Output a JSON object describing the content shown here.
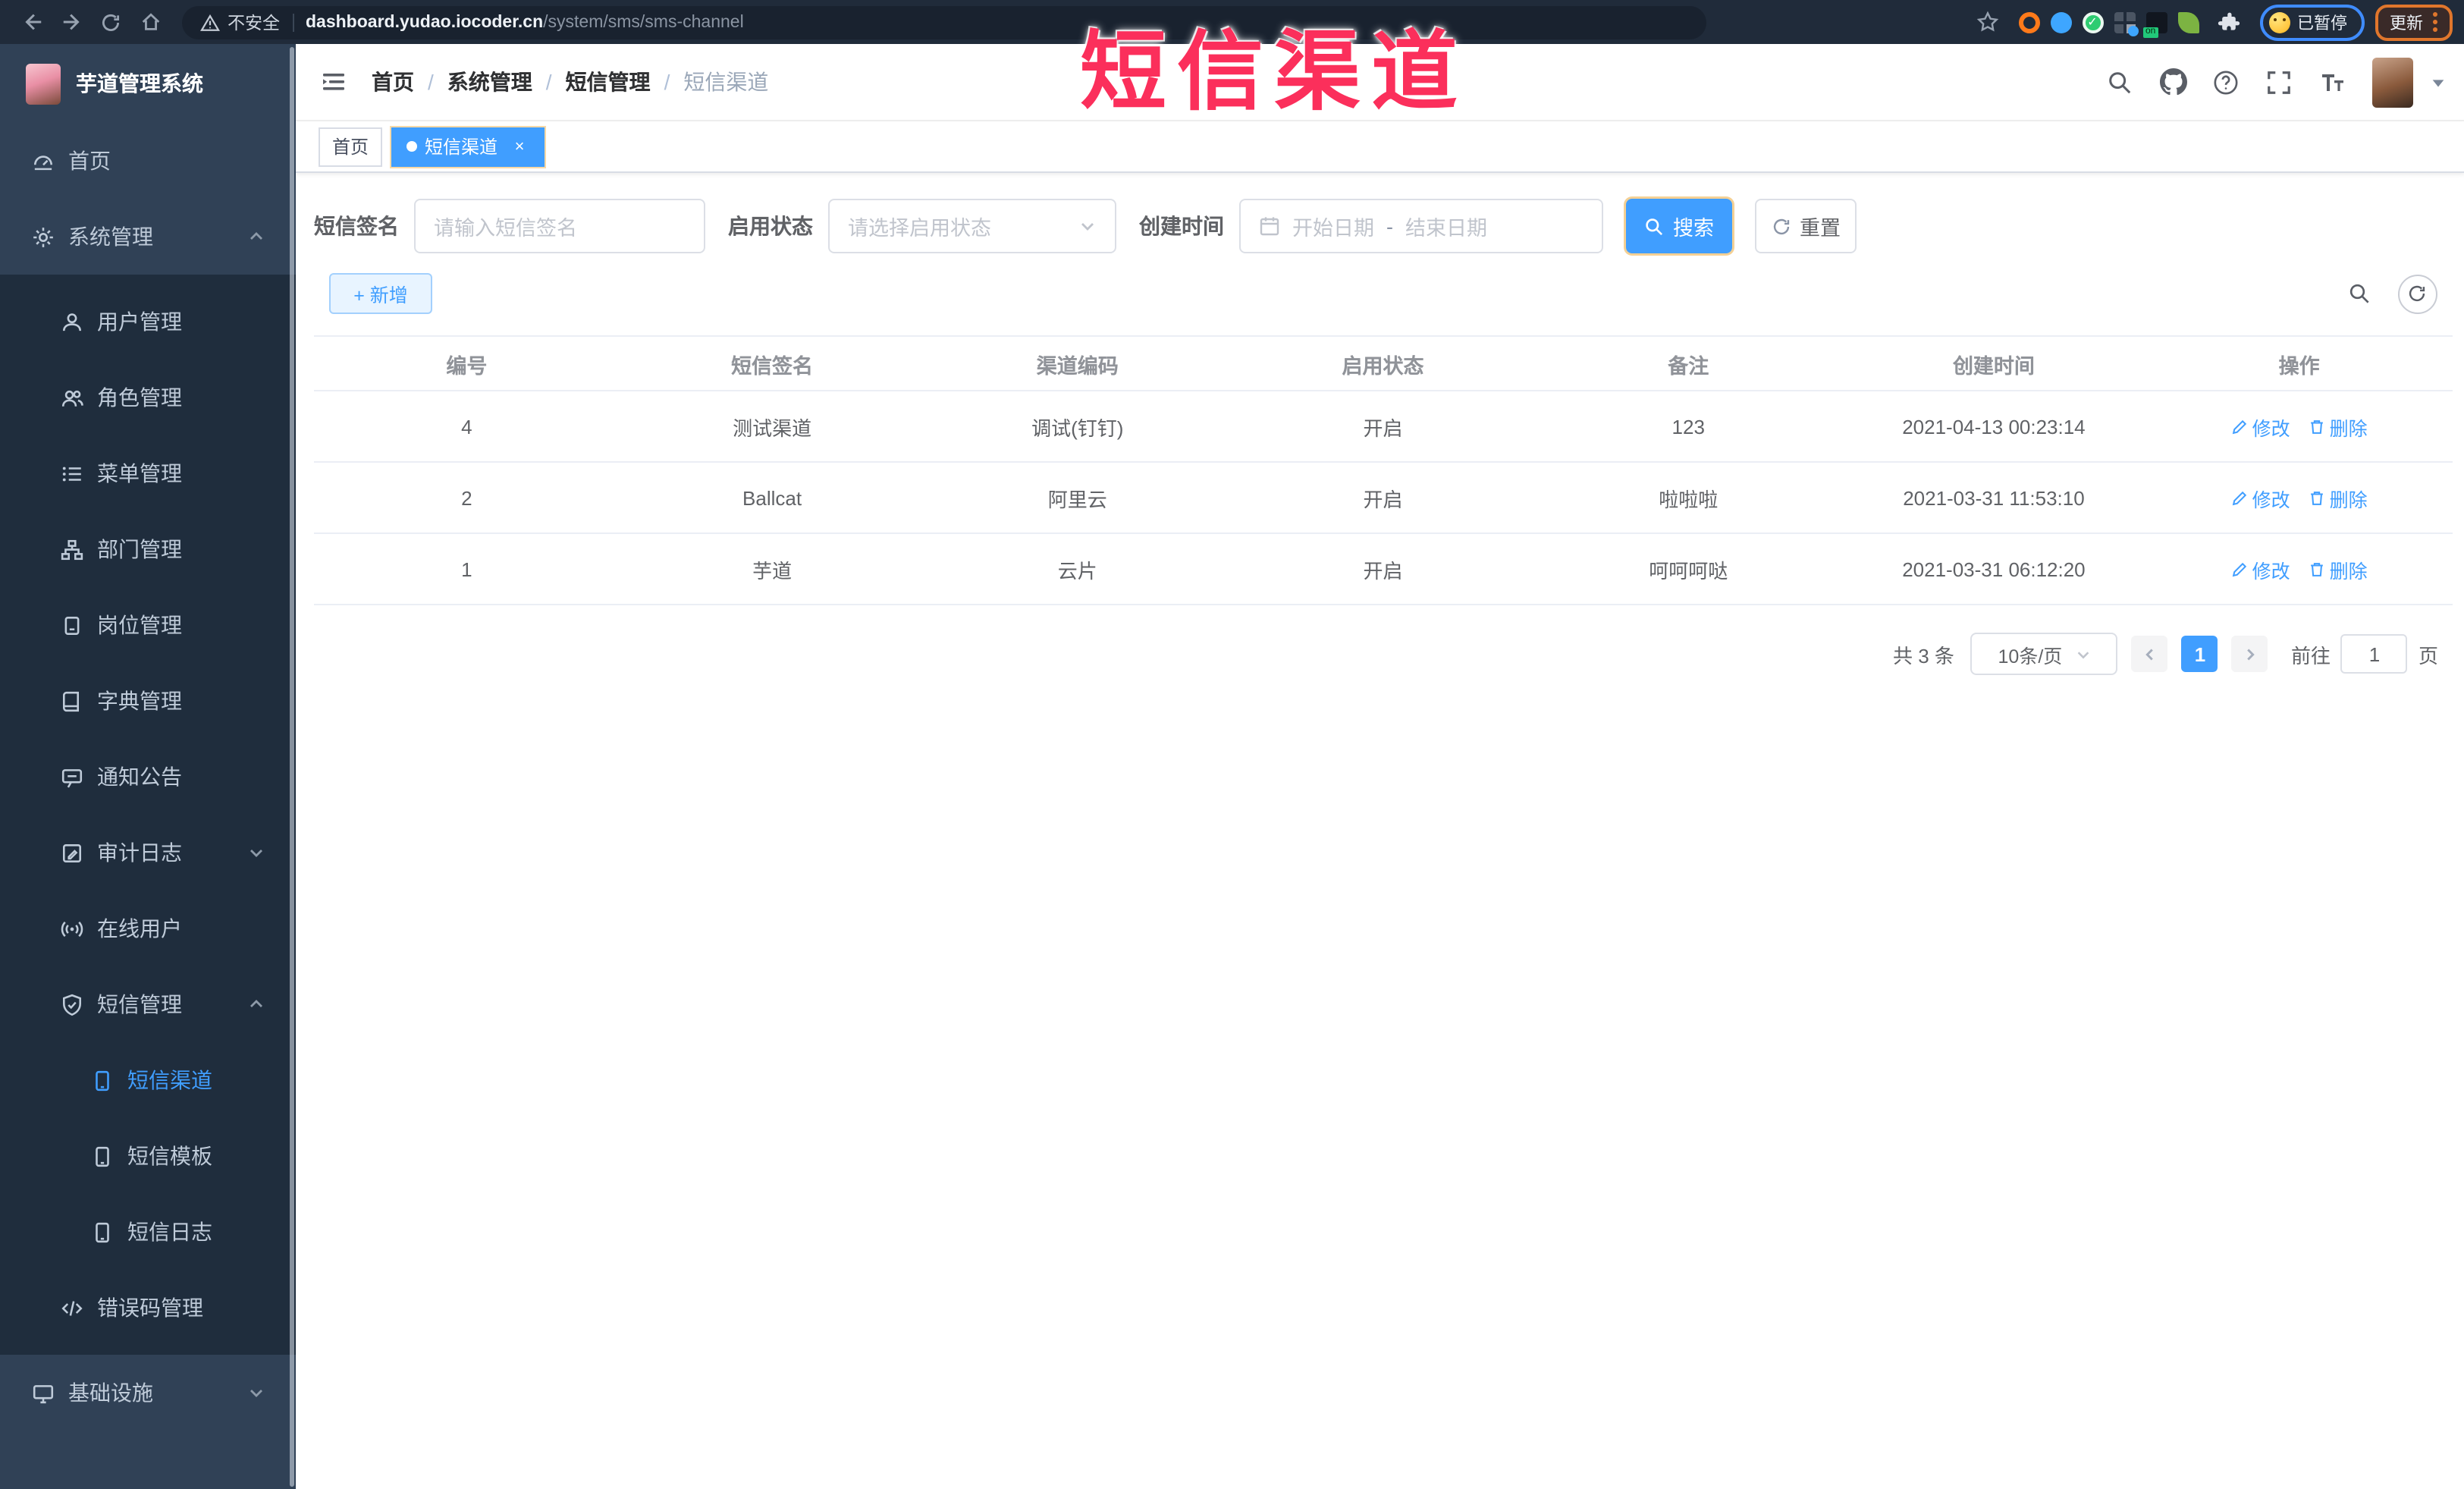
{
  "browser": {
    "security_label": "不安全",
    "url_host": "dashboard.yudao.iocoder.cn",
    "url_path": "/system/sms/sms-channel",
    "paused_label": "已暂停",
    "update_label": "更新"
  },
  "watermark": "短信渠道",
  "sidebar": {
    "title": "芋道管理系统",
    "items": [
      {
        "label": "首页"
      },
      {
        "label": "系统管理"
      },
      {
        "label": "用户管理"
      },
      {
        "label": "角色管理"
      },
      {
        "label": "菜单管理"
      },
      {
        "label": "部门管理"
      },
      {
        "label": "岗位管理"
      },
      {
        "label": "字典管理"
      },
      {
        "label": "通知公告"
      },
      {
        "label": "审计日志"
      },
      {
        "label": "在线用户"
      },
      {
        "label": "短信管理"
      },
      {
        "label": "短信渠道"
      },
      {
        "label": "短信模板"
      },
      {
        "label": "短信日志"
      },
      {
        "label": "错误码管理"
      },
      {
        "label": "基础设施"
      }
    ]
  },
  "navbar": {
    "breadcrumb": [
      "首页",
      "系统管理",
      "短信管理",
      "短信渠道"
    ]
  },
  "tags": {
    "home": "首页",
    "active": "短信渠道",
    "close": "×"
  },
  "filters": {
    "sign_label": "短信签名",
    "sign_placeholder": "请输入短信签名",
    "status_label": "启用状态",
    "status_placeholder": "请选择启用状态",
    "time_label": "创建时间",
    "start_placeholder": "开始日期",
    "separator": "-",
    "end_placeholder": "结束日期",
    "search_label": "搜索",
    "reset_label": "重置"
  },
  "toolbar": {
    "add_label": "+ 新增"
  },
  "table": {
    "headers": [
      "编号",
      "短信签名",
      "渠道编码",
      "启用状态",
      "备注",
      "创建时间",
      "操作"
    ],
    "edit_label": "修改",
    "delete_label": "删除",
    "rows": [
      {
        "id": "4",
        "sign": "测试渠道",
        "code": "调试(钉钉)",
        "status": "开启",
        "remark": "123",
        "time": "2021-04-13 00:23:14"
      },
      {
        "id": "2",
        "sign": "Ballcat",
        "code": "阿里云",
        "status": "开启",
        "remark": "啦啦啦",
        "time": "2021-03-31 11:53:10"
      },
      {
        "id": "1",
        "sign": "芋道",
        "code": "云片",
        "status": "开启",
        "remark": "呵呵呵哒",
        "time": "2021-03-31 06:12:20"
      }
    ]
  },
  "pagination": {
    "total": "共 3 条",
    "page_size": "10条/页",
    "current_page": "1",
    "goto_label": "前往",
    "goto_value": "1",
    "page_unit": "页"
  },
  "colors": {
    "primary": "#409EFF",
    "watermark_red": "#fb2f5b",
    "sidebar_bg": "#304156",
    "submenu_bg": "#1f2d3d"
  }
}
